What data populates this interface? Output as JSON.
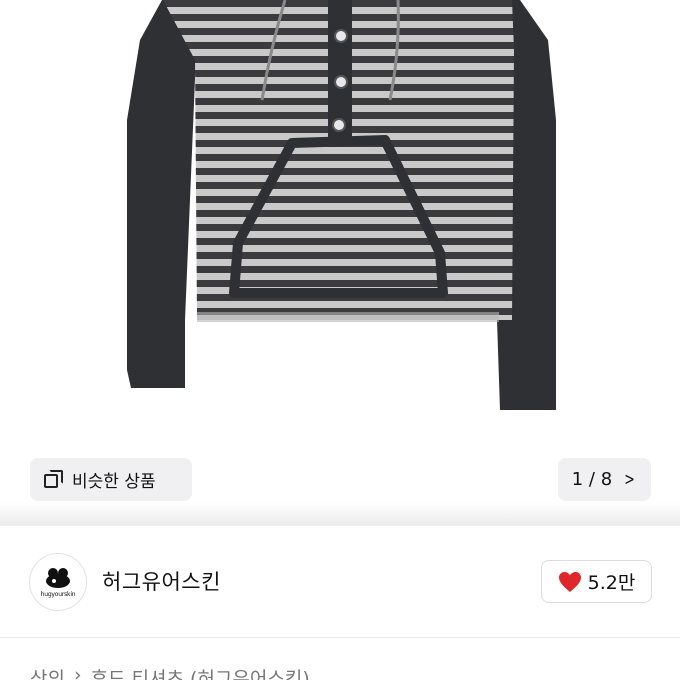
{
  "gallery": {
    "product_image": "striped-hoodie-photo",
    "similar_button_label": "비슷한 상품",
    "pager_text": "1 / 8"
  },
  "shop": {
    "avatar_text": "hugyourskin",
    "name": "허그유어스킨",
    "likes": "5.2만"
  },
  "breadcrumb": {
    "items": [
      "상의",
      "후드 티셔츠 (허그유어스킨)"
    ],
    "separator": "›"
  },
  "colors": {
    "heart": "#e0262b",
    "sleeve": "#2f3033",
    "stripe_dark": "#3d3d40",
    "stripe_light": "#c8c8c8",
    "button_bg": "#f0f0f2"
  }
}
